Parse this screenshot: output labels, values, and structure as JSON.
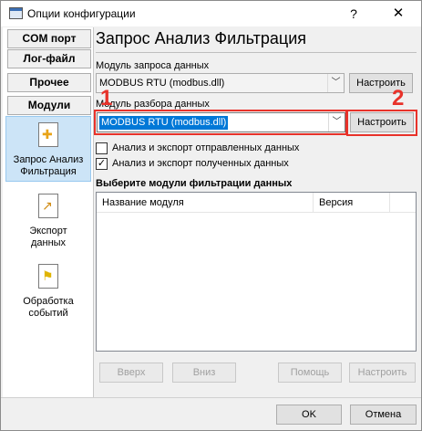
{
  "window": {
    "title": "Опции конфигурации",
    "help": "?",
    "close": "✕"
  },
  "sidebar": {
    "buttons": [
      "COM порт",
      "Лог-файл",
      "Прочее",
      "Модули"
    ],
    "items": [
      {
        "label1": "Запрос Анализ",
        "label2": "Фильтрация",
        "icon": "puzzle-icon",
        "selected": true
      },
      {
        "label1": "Экспорт",
        "label2": "данных",
        "icon": "export-icon",
        "selected": false
      },
      {
        "label1": "Обработка",
        "label2": "событий",
        "icon": "flag-icon",
        "selected": false
      }
    ]
  },
  "main": {
    "title": "Запрос Анализ Фильтрация",
    "request_label": "Модуль запроса данных",
    "request_value": "MODBUS RTU (modbus.dll)",
    "request_button": "Настроить",
    "parse_label": "Модуль разбора данных",
    "parse_value": "MODBUS RTU (modbus.dll)",
    "parse_button": "Настроить",
    "annotation_1": "1",
    "annotation_2": "2",
    "chk_sent": {
      "label": "Анализ и экспорт отправленных данных",
      "checked": false
    },
    "chk_received": {
      "label": "Анализ и экспорт полученных данных",
      "checked": true
    },
    "filter_section": "Выберите модули фильтрации данных",
    "columns": [
      "Название модуля",
      "Версия"
    ],
    "list_buttons": [
      "Вверх",
      "Вниз",
      "Помощь",
      "Настроить"
    ]
  },
  "footer": {
    "ok": "OK",
    "cancel": "Отмена"
  },
  "colors": {
    "accent_red": "#e8322a",
    "selection": "#0078d7",
    "sidebar_selected": "#cce4f7"
  }
}
